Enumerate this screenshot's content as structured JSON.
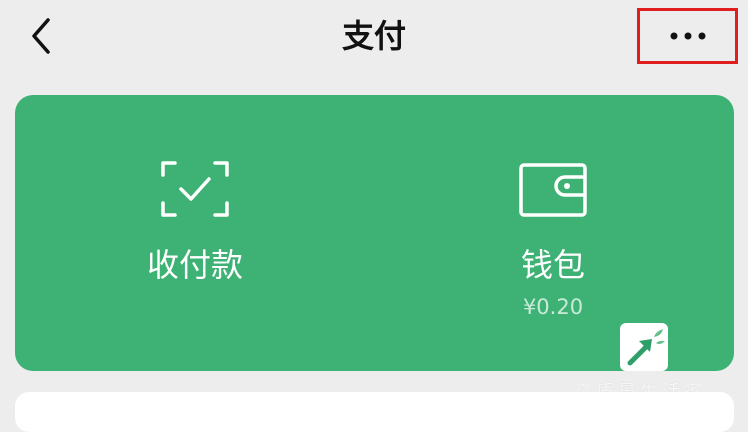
{
  "header": {
    "title": "支付"
  },
  "card": {
    "accent_color": "#3eb275",
    "receive": {
      "label": "收付款",
      "icon": "scan-check-icon"
    },
    "wallet": {
      "label": "钱包",
      "balance": "¥0.20",
      "icon": "wallet-icon"
    }
  },
  "watermark": {
    "text": "高质量生活家"
  },
  "highlight_color": "#e01e1e"
}
